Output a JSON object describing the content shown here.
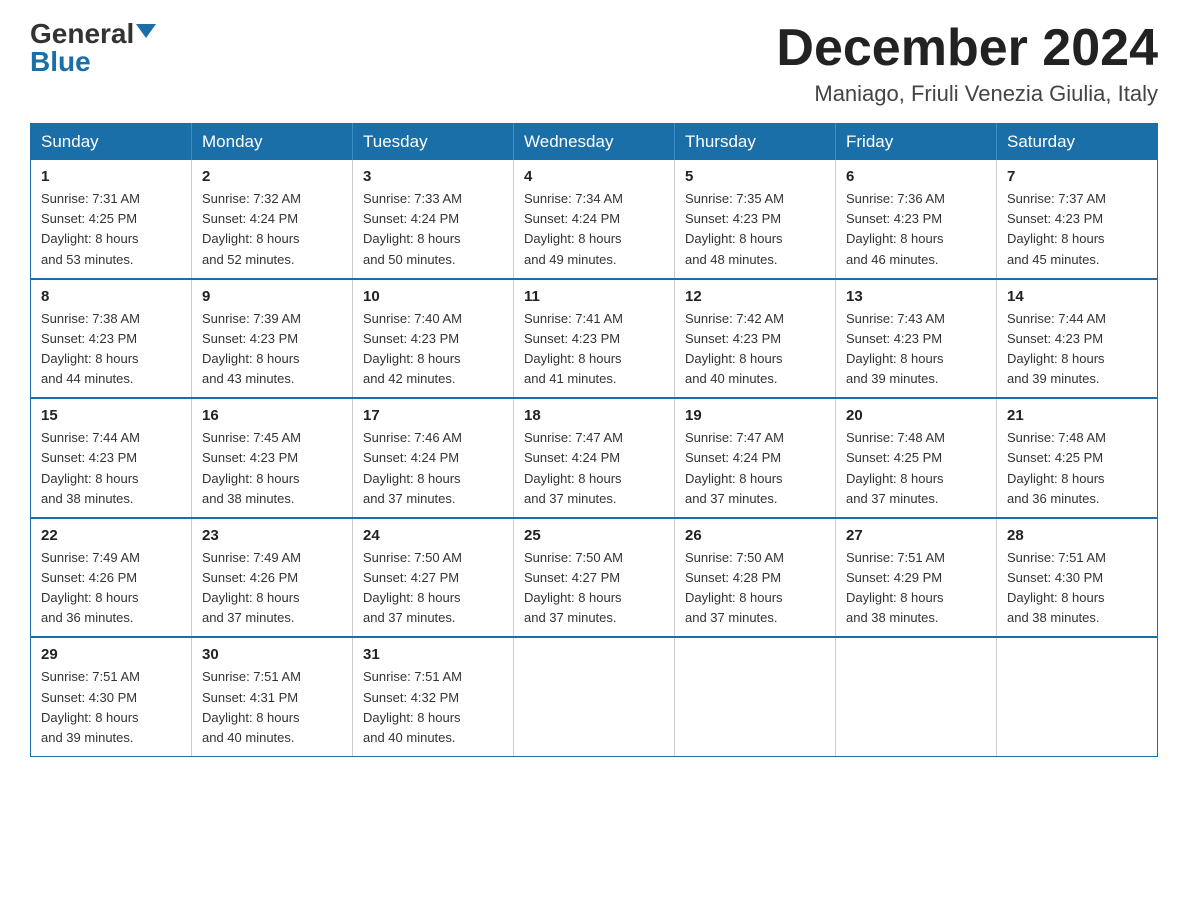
{
  "header": {
    "logo_general": "General",
    "logo_blue": "Blue",
    "month_title": "December 2024",
    "location": "Maniago, Friuli Venezia Giulia, Italy"
  },
  "weekdays": [
    "Sunday",
    "Monday",
    "Tuesday",
    "Wednesday",
    "Thursday",
    "Friday",
    "Saturday"
  ],
  "weeks": [
    [
      {
        "day": "1",
        "sunrise": "7:31 AM",
        "sunset": "4:25 PM",
        "daylight": "8 hours and 53 minutes."
      },
      {
        "day": "2",
        "sunrise": "7:32 AM",
        "sunset": "4:24 PM",
        "daylight": "8 hours and 52 minutes."
      },
      {
        "day": "3",
        "sunrise": "7:33 AM",
        "sunset": "4:24 PM",
        "daylight": "8 hours and 50 minutes."
      },
      {
        "day": "4",
        "sunrise": "7:34 AM",
        "sunset": "4:24 PM",
        "daylight": "8 hours and 49 minutes."
      },
      {
        "day": "5",
        "sunrise": "7:35 AM",
        "sunset": "4:23 PM",
        "daylight": "8 hours and 48 minutes."
      },
      {
        "day": "6",
        "sunrise": "7:36 AM",
        "sunset": "4:23 PM",
        "daylight": "8 hours and 46 minutes."
      },
      {
        "day": "7",
        "sunrise": "7:37 AM",
        "sunset": "4:23 PM",
        "daylight": "8 hours and 45 minutes."
      }
    ],
    [
      {
        "day": "8",
        "sunrise": "7:38 AM",
        "sunset": "4:23 PM",
        "daylight": "8 hours and 44 minutes."
      },
      {
        "day": "9",
        "sunrise": "7:39 AM",
        "sunset": "4:23 PM",
        "daylight": "8 hours and 43 minutes."
      },
      {
        "day": "10",
        "sunrise": "7:40 AM",
        "sunset": "4:23 PM",
        "daylight": "8 hours and 42 minutes."
      },
      {
        "day": "11",
        "sunrise": "7:41 AM",
        "sunset": "4:23 PM",
        "daylight": "8 hours and 41 minutes."
      },
      {
        "day": "12",
        "sunrise": "7:42 AM",
        "sunset": "4:23 PM",
        "daylight": "8 hours and 40 minutes."
      },
      {
        "day": "13",
        "sunrise": "7:43 AM",
        "sunset": "4:23 PM",
        "daylight": "8 hours and 39 minutes."
      },
      {
        "day": "14",
        "sunrise": "7:44 AM",
        "sunset": "4:23 PM",
        "daylight": "8 hours and 39 minutes."
      }
    ],
    [
      {
        "day": "15",
        "sunrise": "7:44 AM",
        "sunset": "4:23 PM",
        "daylight": "8 hours and 38 minutes."
      },
      {
        "day": "16",
        "sunrise": "7:45 AM",
        "sunset": "4:23 PM",
        "daylight": "8 hours and 38 minutes."
      },
      {
        "day": "17",
        "sunrise": "7:46 AM",
        "sunset": "4:24 PM",
        "daylight": "8 hours and 37 minutes."
      },
      {
        "day": "18",
        "sunrise": "7:47 AM",
        "sunset": "4:24 PM",
        "daylight": "8 hours and 37 minutes."
      },
      {
        "day": "19",
        "sunrise": "7:47 AM",
        "sunset": "4:24 PM",
        "daylight": "8 hours and 37 minutes."
      },
      {
        "day": "20",
        "sunrise": "7:48 AM",
        "sunset": "4:25 PM",
        "daylight": "8 hours and 37 minutes."
      },
      {
        "day": "21",
        "sunrise": "7:48 AM",
        "sunset": "4:25 PM",
        "daylight": "8 hours and 36 minutes."
      }
    ],
    [
      {
        "day": "22",
        "sunrise": "7:49 AM",
        "sunset": "4:26 PM",
        "daylight": "8 hours and 36 minutes."
      },
      {
        "day": "23",
        "sunrise": "7:49 AM",
        "sunset": "4:26 PM",
        "daylight": "8 hours and 37 minutes."
      },
      {
        "day": "24",
        "sunrise": "7:50 AM",
        "sunset": "4:27 PM",
        "daylight": "8 hours and 37 minutes."
      },
      {
        "day": "25",
        "sunrise": "7:50 AM",
        "sunset": "4:27 PM",
        "daylight": "8 hours and 37 minutes."
      },
      {
        "day": "26",
        "sunrise": "7:50 AM",
        "sunset": "4:28 PM",
        "daylight": "8 hours and 37 minutes."
      },
      {
        "day": "27",
        "sunrise": "7:51 AM",
        "sunset": "4:29 PM",
        "daylight": "8 hours and 38 minutes."
      },
      {
        "day": "28",
        "sunrise": "7:51 AM",
        "sunset": "4:30 PM",
        "daylight": "8 hours and 38 minutes."
      }
    ],
    [
      {
        "day": "29",
        "sunrise": "7:51 AM",
        "sunset": "4:30 PM",
        "daylight": "8 hours and 39 minutes."
      },
      {
        "day": "30",
        "sunrise": "7:51 AM",
        "sunset": "4:31 PM",
        "daylight": "8 hours and 40 minutes."
      },
      {
        "day": "31",
        "sunrise": "7:51 AM",
        "sunset": "4:32 PM",
        "daylight": "8 hours and 40 minutes."
      },
      null,
      null,
      null,
      null
    ]
  ],
  "labels": {
    "sunrise": "Sunrise:",
    "sunset": "Sunset:",
    "daylight": "Daylight:"
  }
}
